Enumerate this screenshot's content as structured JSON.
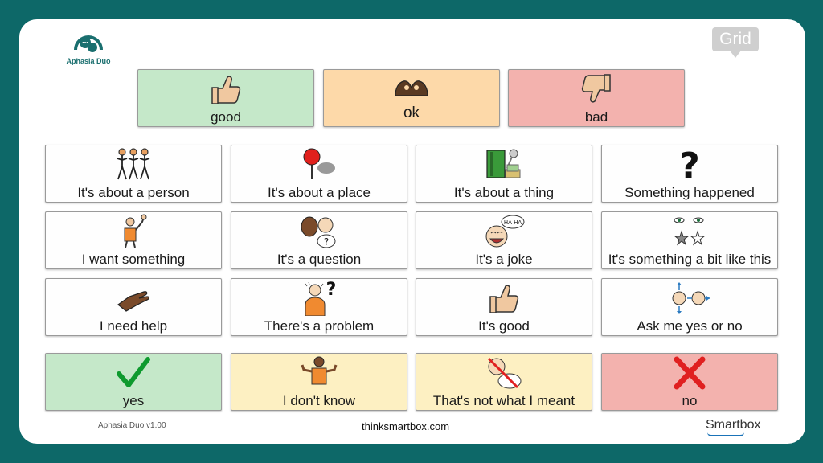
{
  "app": {
    "logo_text": "Aphasia Duo",
    "grid_logo": "Grid"
  },
  "top_row": [
    {
      "label": "good",
      "icon": "thumbs-up-icon",
      "color": "#c5e8c9"
    },
    {
      "label": "ok",
      "icon": "ok-hands-icon",
      "color": "#fdd9a9"
    },
    {
      "label": "bad",
      "icon": "thumbs-down-icon",
      "color": "#f3b2ae"
    }
  ],
  "grid": [
    {
      "label": "It's about a person",
      "icon": "people-icon"
    },
    {
      "label": "It's about a place",
      "icon": "map-pin-icon"
    },
    {
      "label": "It's about a thing",
      "icon": "things-icon"
    },
    {
      "label": "Something happened",
      "icon": "question-mark-icon"
    },
    {
      "label": "I want something",
      "icon": "person-raising-hand-icon"
    },
    {
      "label": "It's a question",
      "icon": "question-faces-icon"
    },
    {
      "label": "It's a joke",
      "icon": "laughing-face-icon"
    },
    {
      "label": "It's something a bit like this",
      "icon": "eyes-stars-icon"
    },
    {
      "label": "I need help",
      "icon": "helping-hand-icon"
    },
    {
      "label": "There's a problem",
      "icon": "problem-person-icon"
    },
    {
      "label": "It's good",
      "icon": "thumbs-up-icon"
    },
    {
      "label": "Ask me yes or no",
      "icon": "yes-no-faces-icon"
    }
  ],
  "bottom_row": [
    {
      "label": "yes",
      "icon": "check-icon",
      "color": "#c5e8c9"
    },
    {
      "label": "I don't know",
      "icon": "shrug-icon",
      "color": "#fdf0c2"
    },
    {
      "label": "That's not what I meant",
      "icon": "not-meant-icon",
      "color": "#fdf0c2"
    },
    {
      "label": "no",
      "icon": "cross-icon",
      "color": "#f3b2ae"
    }
  ],
  "footer": {
    "version": "Aphasia Duo v1.00",
    "website": "thinksmartbox.com",
    "brand": "Smartbox"
  },
  "colors": {
    "background": "#0d6868",
    "accent": "#1a6f6f",
    "check": "#0e9a2e",
    "cross": "#e02020"
  }
}
